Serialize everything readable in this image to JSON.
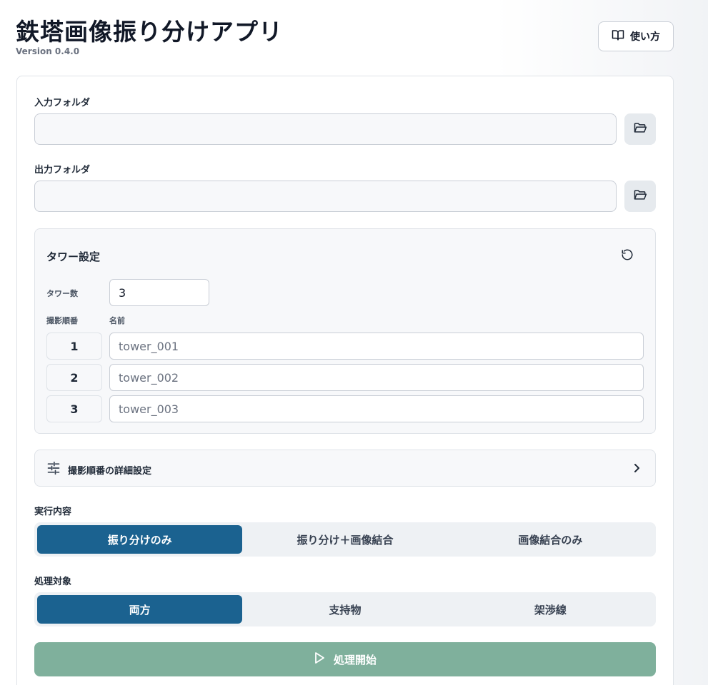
{
  "app": {
    "title": "鉄塔画像振り分けアプリ",
    "version": "Version 0.4.0",
    "help_label": "使い方"
  },
  "input_folder": {
    "label": "入力フォルダ",
    "value": ""
  },
  "output_folder": {
    "label": "出力フォルダ",
    "value": ""
  },
  "tower_settings": {
    "title": "タワー設定",
    "count_label": "タワー数",
    "count_value": "3",
    "order_header": "撮影順番",
    "name_header": "名前",
    "rows": [
      {
        "order": "1",
        "name": "tower_001"
      },
      {
        "order": "2",
        "name": "tower_002"
      },
      {
        "order": "3",
        "name": "tower_003"
      }
    ]
  },
  "detail_settings": {
    "label": "撮影順番の詳細設定"
  },
  "execution": {
    "label": "実行内容",
    "options": [
      "振り分けのみ",
      "振り分け＋画像結合",
      "画像結合のみ"
    ],
    "selected": 0
  },
  "target": {
    "label": "処理対象",
    "options": [
      "両方",
      "支持物",
      "架渉線"
    ],
    "selected": 0
  },
  "start_button": {
    "label": "処理開始"
  },
  "colors": {
    "accent": "#1b6290",
    "start_button": "#7fb09c",
    "segment_bg": "#eef1f4"
  }
}
